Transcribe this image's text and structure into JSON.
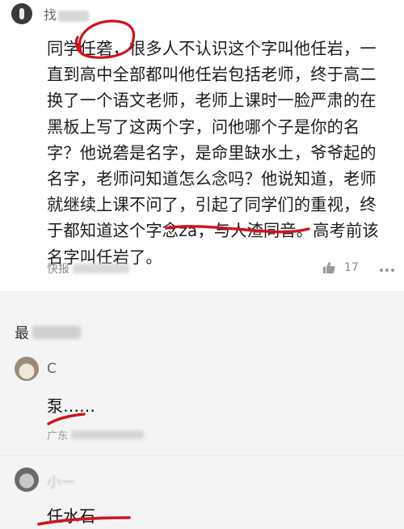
{
  "post": {
    "author_visible": "找",
    "body": "同学任砻，很多人不认识这个字叫他任岩，一直到高中全部都叫他任岩包括老师，终于高二换了一个语文老师，老师上课时一脸严肃的在黑板上写了这两个字，问他哪个子是你的名字？他说砻是名字，是命里缺水土，爷爷起的名字，老师问知道怎么念吗？他说知道，老师就继续上课不问了，引起了同学们的重视，终于都知道这个字念za，与人渣同音。高考前该名字叫任岩了。",
    "source_label": "快报",
    "like_count": "17",
    "icons": {
      "like": "thumbs-up-icon",
      "more": "more-dots-icon"
    }
  },
  "comments_section": {
    "title": "最"
  },
  "comments": [
    {
      "name": "C",
      "text": "泵……",
      "meta": "广东"
    },
    {
      "name": "小一",
      "text": "任水石"
    }
  ],
  "colors": {
    "annotation_red": "#d0141c",
    "page_gray": "#f4f4f4"
  }
}
